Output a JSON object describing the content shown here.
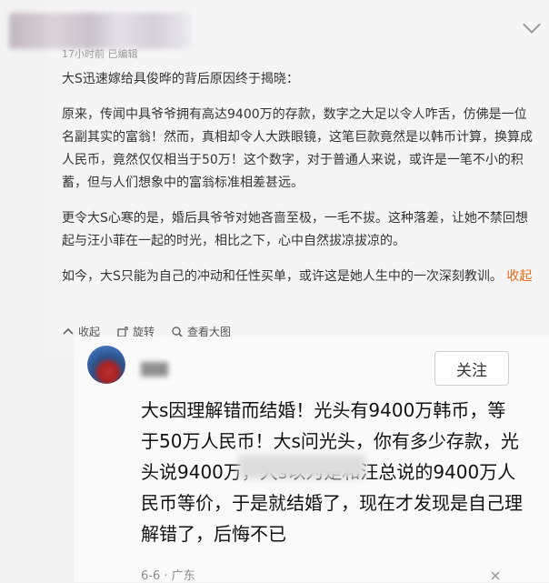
{
  "post": {
    "meta": "17小时前 已编辑",
    "paragraphs": [
      "大S迅速嫁给具俊晔的背后原因终于揭晓：",
      "原来，传闻中具爷爷拥有高达9400万的存款，数字之大足以令人咋舌，仿佛是一位名副其实的富翁！然而，真相却令人大跌眼镜，这笔巨款竟然是以韩币计算，换算成人民币，竟然仅仅相当于50万！这个数字，对于普通人来说，或许是一笔不小的积蓄，但与人们想象中的富翁标准相差甚远。",
      "更令大S心寒的是，婚后具爷爷对她吝啬至极，一毛不拔。这种落差，让她不禁回想起与汪小菲在一起的时光，相比之下，心中自然拔凉拔凉的。",
      "如今，大S只能为自己的冲动和任性买单，或许这是她人生中的一次深刻教训。"
    ],
    "collapse": "收起"
  },
  "actions": {
    "collect": "收起",
    "rotate": "旋转",
    "view_large": "查看大图"
  },
  "comment": {
    "follow_label": "关注",
    "text": "大s因理解错而结婚！光头有9400万韩币，等于50万人民币！大s问光头，你有多少存款，光头说9400万，大s以为是和汪总说的9400万人民币等价，于是就结婚了，现在才发现是自己理解错了，后悔不已",
    "date": "6-6 · 广东"
  },
  "colors": {
    "accent": "#e86a1a"
  }
}
